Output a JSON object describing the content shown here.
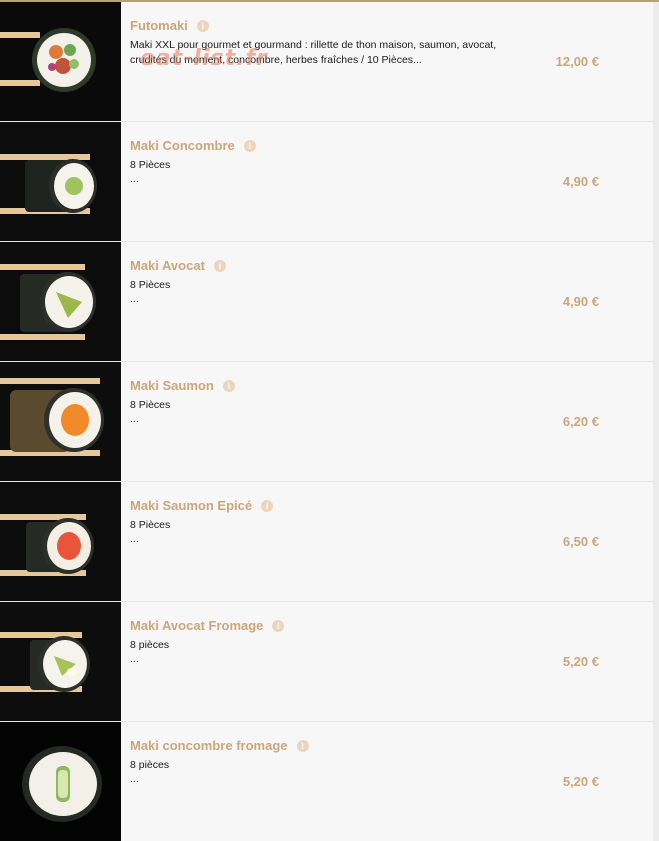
{
  "watermark": "eat-list.fr",
  "colors": {
    "accent": "#c9a67e",
    "info_badge": "#ecd5bc",
    "top_border": "#b8a07a"
  },
  "items": [
    {
      "title": "Futomaki",
      "description": "Maki XXL pour gourmet et gourmand : rillette de thon maison, saumon, avocat, crudités du moment, concombre, herbes fraîches / 10 Pièces...",
      "ellipsis": "",
      "price": "12,00 €",
      "image": "futomaki-photo"
    },
    {
      "title": "Maki Concombre",
      "description": "8 Pièces",
      "ellipsis": "...",
      "price": "4,90 €",
      "image": "maki-cucumber-photo"
    },
    {
      "title": "Maki Avocat",
      "description": "8 Pièces",
      "ellipsis": "...",
      "price": "4,90 €",
      "image": "maki-avocado-photo"
    },
    {
      "title": "Maki Saumon",
      "description": "8 Pièces",
      "ellipsis": "...",
      "price": "6,20 €",
      "image": "maki-salmon-photo"
    },
    {
      "title": "Maki Saumon Epicé",
      "description": "8 Pièces",
      "ellipsis": "...",
      "price": "6,50 €",
      "image": "maki-spicy-salmon-photo"
    },
    {
      "title": "Maki Avocat Fromage",
      "description": "8 pièces",
      "ellipsis": "...",
      "price": "5,20 €",
      "image": "maki-avocado-cheese-photo"
    },
    {
      "title": "Maki concombre fromage",
      "description": "8 pièces",
      "ellipsis": "...",
      "price": "5,20 €",
      "image": "maki-cucumber-cheese-photo"
    }
  ]
}
